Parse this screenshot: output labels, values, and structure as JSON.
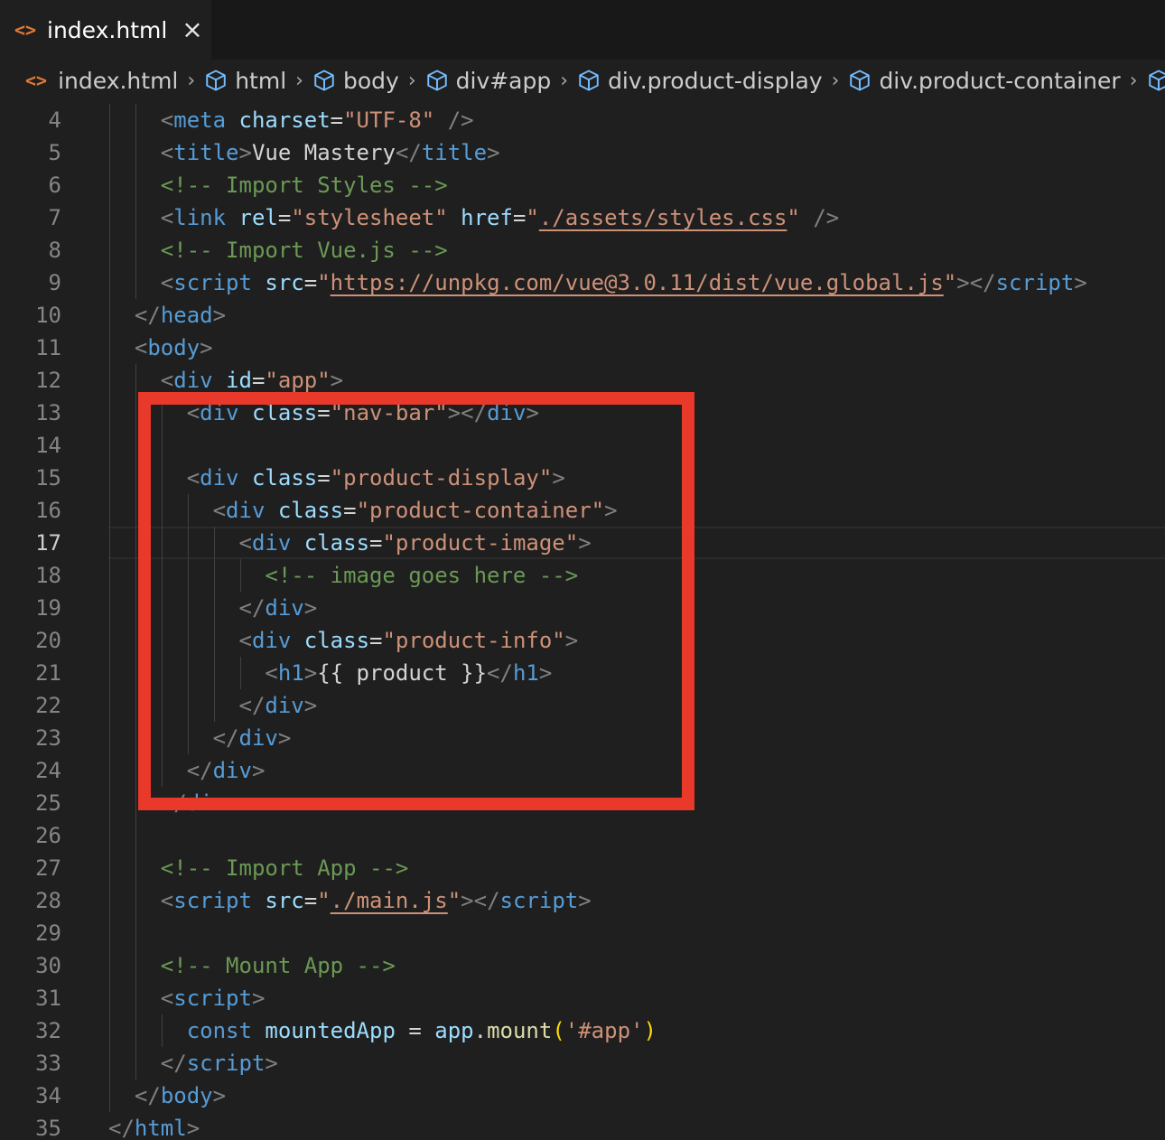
{
  "tab": {
    "label": "index.html",
    "icon": "code-file-icon",
    "close_icon": "close-icon"
  },
  "breadcrumb": [
    {
      "label": "index.html",
      "icon": "code-file-icon"
    },
    {
      "label": "html",
      "icon": "cube-icon"
    },
    {
      "label": "body",
      "icon": "cube-icon"
    },
    {
      "label": "div#app",
      "icon": "cube-icon"
    },
    {
      "label": "div.product-display",
      "icon": "cube-icon"
    },
    {
      "label": "div.product-container",
      "icon": "cube-icon"
    },
    {
      "label": "",
      "icon": "cube-icon"
    }
  ],
  "editor": {
    "language": "html",
    "active_line": 17,
    "lines": [
      {
        "n": 4,
        "indent": 4,
        "tokens": [
          [
            "punc",
            "<"
          ],
          [
            "tag",
            "meta"
          ],
          [
            "txt",
            " "
          ],
          [
            "attr",
            "charset"
          ],
          [
            "txt",
            "="
          ],
          [
            "str",
            "\"UTF-8\""
          ],
          [
            "txt",
            " "
          ],
          [
            "punc",
            "/>"
          ]
        ]
      },
      {
        "n": 5,
        "indent": 4,
        "tokens": [
          [
            "punc",
            "<"
          ],
          [
            "tag",
            "title"
          ],
          [
            "punc",
            ">"
          ],
          [
            "txt",
            "Vue Mastery"
          ],
          [
            "punc",
            "</"
          ],
          [
            "tag",
            "title"
          ],
          [
            "punc",
            ">"
          ]
        ]
      },
      {
        "n": 6,
        "indent": 4,
        "tokens": [
          [
            "cmt",
            "<!-- Import Styles -->"
          ]
        ]
      },
      {
        "n": 7,
        "indent": 4,
        "tokens": [
          [
            "punc",
            "<"
          ],
          [
            "tag",
            "link"
          ],
          [
            "txt",
            " "
          ],
          [
            "attr",
            "rel"
          ],
          [
            "txt",
            "="
          ],
          [
            "str",
            "\"stylesheet\""
          ],
          [
            "txt",
            " "
          ],
          [
            "attr",
            "href"
          ],
          [
            "txt",
            "="
          ],
          [
            "str",
            "\""
          ],
          [
            "link",
            "./assets/styles.css"
          ],
          [
            "str",
            "\""
          ],
          [
            "txt",
            " "
          ],
          [
            "punc",
            "/>"
          ]
        ]
      },
      {
        "n": 8,
        "indent": 4,
        "tokens": [
          [
            "cmt",
            "<!-- Import Vue.js -->"
          ]
        ]
      },
      {
        "n": 9,
        "indent": 4,
        "tokens": [
          [
            "punc",
            "<"
          ],
          [
            "tag",
            "script"
          ],
          [
            "txt",
            " "
          ],
          [
            "attr",
            "src"
          ],
          [
            "txt",
            "="
          ],
          [
            "str",
            "\""
          ],
          [
            "link",
            "https://unpkg.com/vue@3.0.11/dist/vue.global.js"
          ],
          [
            "str",
            "\""
          ],
          [
            "punc",
            "></"
          ],
          [
            "tag",
            "script"
          ],
          [
            "punc",
            ">"
          ]
        ]
      },
      {
        "n": 10,
        "indent": 2,
        "tokens": [
          [
            "punc",
            "</"
          ],
          [
            "tag",
            "head"
          ],
          [
            "punc",
            ">"
          ]
        ]
      },
      {
        "n": 11,
        "indent": 2,
        "tokens": [
          [
            "punc",
            "<"
          ],
          [
            "tag",
            "body"
          ],
          [
            "punc",
            ">"
          ]
        ]
      },
      {
        "n": 12,
        "indent": 4,
        "tokens": [
          [
            "punc",
            "<"
          ],
          [
            "tag",
            "div"
          ],
          [
            "txt",
            " "
          ],
          [
            "attr",
            "id"
          ],
          [
            "txt",
            "="
          ],
          [
            "str",
            "\"app\""
          ],
          [
            "punc",
            ">"
          ]
        ]
      },
      {
        "n": 13,
        "indent": 6,
        "tokens": [
          [
            "punc",
            "<"
          ],
          [
            "tag",
            "div"
          ],
          [
            "txt",
            " "
          ],
          [
            "attr",
            "class"
          ],
          [
            "txt",
            "="
          ],
          [
            "str",
            "\"nav-bar\""
          ],
          [
            "punc",
            "></"
          ],
          [
            "tag",
            "div"
          ],
          [
            "punc",
            ">"
          ]
        ]
      },
      {
        "n": 14,
        "indent": 0,
        "tokens": []
      },
      {
        "n": 15,
        "indent": 6,
        "tokens": [
          [
            "punc",
            "<"
          ],
          [
            "tag",
            "div"
          ],
          [
            "txt",
            " "
          ],
          [
            "attr",
            "class"
          ],
          [
            "txt",
            "="
          ],
          [
            "str",
            "\"product-display\""
          ],
          [
            "punc",
            ">"
          ]
        ]
      },
      {
        "n": 16,
        "indent": 8,
        "tokens": [
          [
            "punc",
            "<"
          ],
          [
            "tag",
            "div"
          ],
          [
            "txt",
            " "
          ],
          [
            "attr",
            "class"
          ],
          [
            "txt",
            "="
          ],
          [
            "str",
            "\"product-container\""
          ],
          [
            "punc",
            ">"
          ]
        ]
      },
      {
        "n": 17,
        "indent": 10,
        "tokens": [
          [
            "punc",
            "<"
          ],
          [
            "tag",
            "div"
          ],
          [
            "txt",
            " "
          ],
          [
            "attr",
            "class"
          ],
          [
            "txt",
            "="
          ],
          [
            "str",
            "\"product-image\""
          ],
          [
            "punc",
            ">"
          ]
        ]
      },
      {
        "n": 18,
        "indent": 12,
        "tokens": [
          [
            "cmt",
            "<!-- image goes here -->"
          ]
        ]
      },
      {
        "n": 19,
        "indent": 10,
        "tokens": [
          [
            "punc",
            "</"
          ],
          [
            "tag",
            "div"
          ],
          [
            "punc",
            ">"
          ]
        ]
      },
      {
        "n": 20,
        "indent": 10,
        "tokens": [
          [
            "punc",
            "<"
          ],
          [
            "tag",
            "div"
          ],
          [
            "txt",
            " "
          ],
          [
            "attr",
            "class"
          ],
          [
            "txt",
            "="
          ],
          [
            "str",
            "\"product-info\""
          ],
          [
            "punc",
            ">"
          ]
        ]
      },
      {
        "n": 21,
        "indent": 12,
        "tokens": [
          [
            "punc",
            "<"
          ],
          [
            "tag",
            "h1"
          ],
          [
            "punc",
            ">"
          ],
          [
            "txt",
            "{{ product }}"
          ],
          [
            "punc",
            "</"
          ],
          [
            "tag",
            "h1"
          ],
          [
            "punc",
            ">"
          ]
        ]
      },
      {
        "n": 22,
        "indent": 10,
        "tokens": [
          [
            "punc",
            "</"
          ],
          [
            "tag",
            "div"
          ],
          [
            "punc",
            ">"
          ]
        ]
      },
      {
        "n": 23,
        "indent": 8,
        "tokens": [
          [
            "punc",
            "</"
          ],
          [
            "tag",
            "div"
          ],
          [
            "punc",
            ">"
          ]
        ]
      },
      {
        "n": 24,
        "indent": 6,
        "tokens": [
          [
            "punc",
            "</"
          ],
          [
            "tag",
            "div"
          ],
          [
            "punc",
            ">"
          ]
        ]
      },
      {
        "n": 25,
        "indent": 4,
        "tokens": [
          [
            "punc",
            "</"
          ],
          [
            "tag",
            "div"
          ],
          [
            "punc",
            ">"
          ]
        ]
      },
      {
        "n": 26,
        "indent": 0,
        "tokens": []
      },
      {
        "n": 27,
        "indent": 4,
        "tokens": [
          [
            "cmt",
            "<!-- Import App -->"
          ]
        ]
      },
      {
        "n": 28,
        "indent": 4,
        "tokens": [
          [
            "punc",
            "<"
          ],
          [
            "tag",
            "script"
          ],
          [
            "txt",
            " "
          ],
          [
            "attr",
            "src"
          ],
          [
            "txt",
            "="
          ],
          [
            "str",
            "\""
          ],
          [
            "link",
            "./main.js"
          ],
          [
            "str",
            "\""
          ],
          [
            "punc",
            "></"
          ],
          [
            "tag",
            "script"
          ],
          [
            "punc",
            ">"
          ]
        ]
      },
      {
        "n": 29,
        "indent": 0,
        "tokens": []
      },
      {
        "n": 30,
        "indent": 4,
        "tokens": [
          [
            "cmt",
            "<!-- Mount App -->"
          ]
        ]
      },
      {
        "n": 31,
        "indent": 4,
        "tokens": [
          [
            "punc",
            "<"
          ],
          [
            "tag",
            "script"
          ],
          [
            "punc",
            ">"
          ]
        ]
      },
      {
        "n": 32,
        "indent": 6,
        "tokens": [
          [
            "kw",
            "const"
          ],
          [
            "txt",
            " "
          ],
          [
            "var",
            "mountedApp"
          ],
          [
            "op",
            " = "
          ],
          [
            "var",
            "app"
          ],
          [
            "op",
            "."
          ],
          [
            "fn",
            "mount"
          ],
          [
            "br",
            "("
          ],
          [
            "str",
            "'#app'"
          ],
          [
            "br",
            ")"
          ]
        ]
      },
      {
        "n": 33,
        "indent": 4,
        "tokens": [
          [
            "punc",
            "</"
          ],
          [
            "tag",
            "script"
          ],
          [
            "punc",
            ">"
          ]
        ]
      },
      {
        "n": 34,
        "indent": 2,
        "tokens": [
          [
            "punc",
            "</"
          ],
          [
            "tag",
            "body"
          ],
          [
            "punc",
            ">"
          ]
        ]
      },
      {
        "n": 35,
        "indent": 0,
        "tokens": [
          [
            "punc",
            "</"
          ],
          [
            "tag",
            "html"
          ],
          [
            "punc",
            ">"
          ]
        ]
      }
    ]
  },
  "annotation": {
    "color": "#e8392a",
    "shape": "rectangle-outline"
  }
}
